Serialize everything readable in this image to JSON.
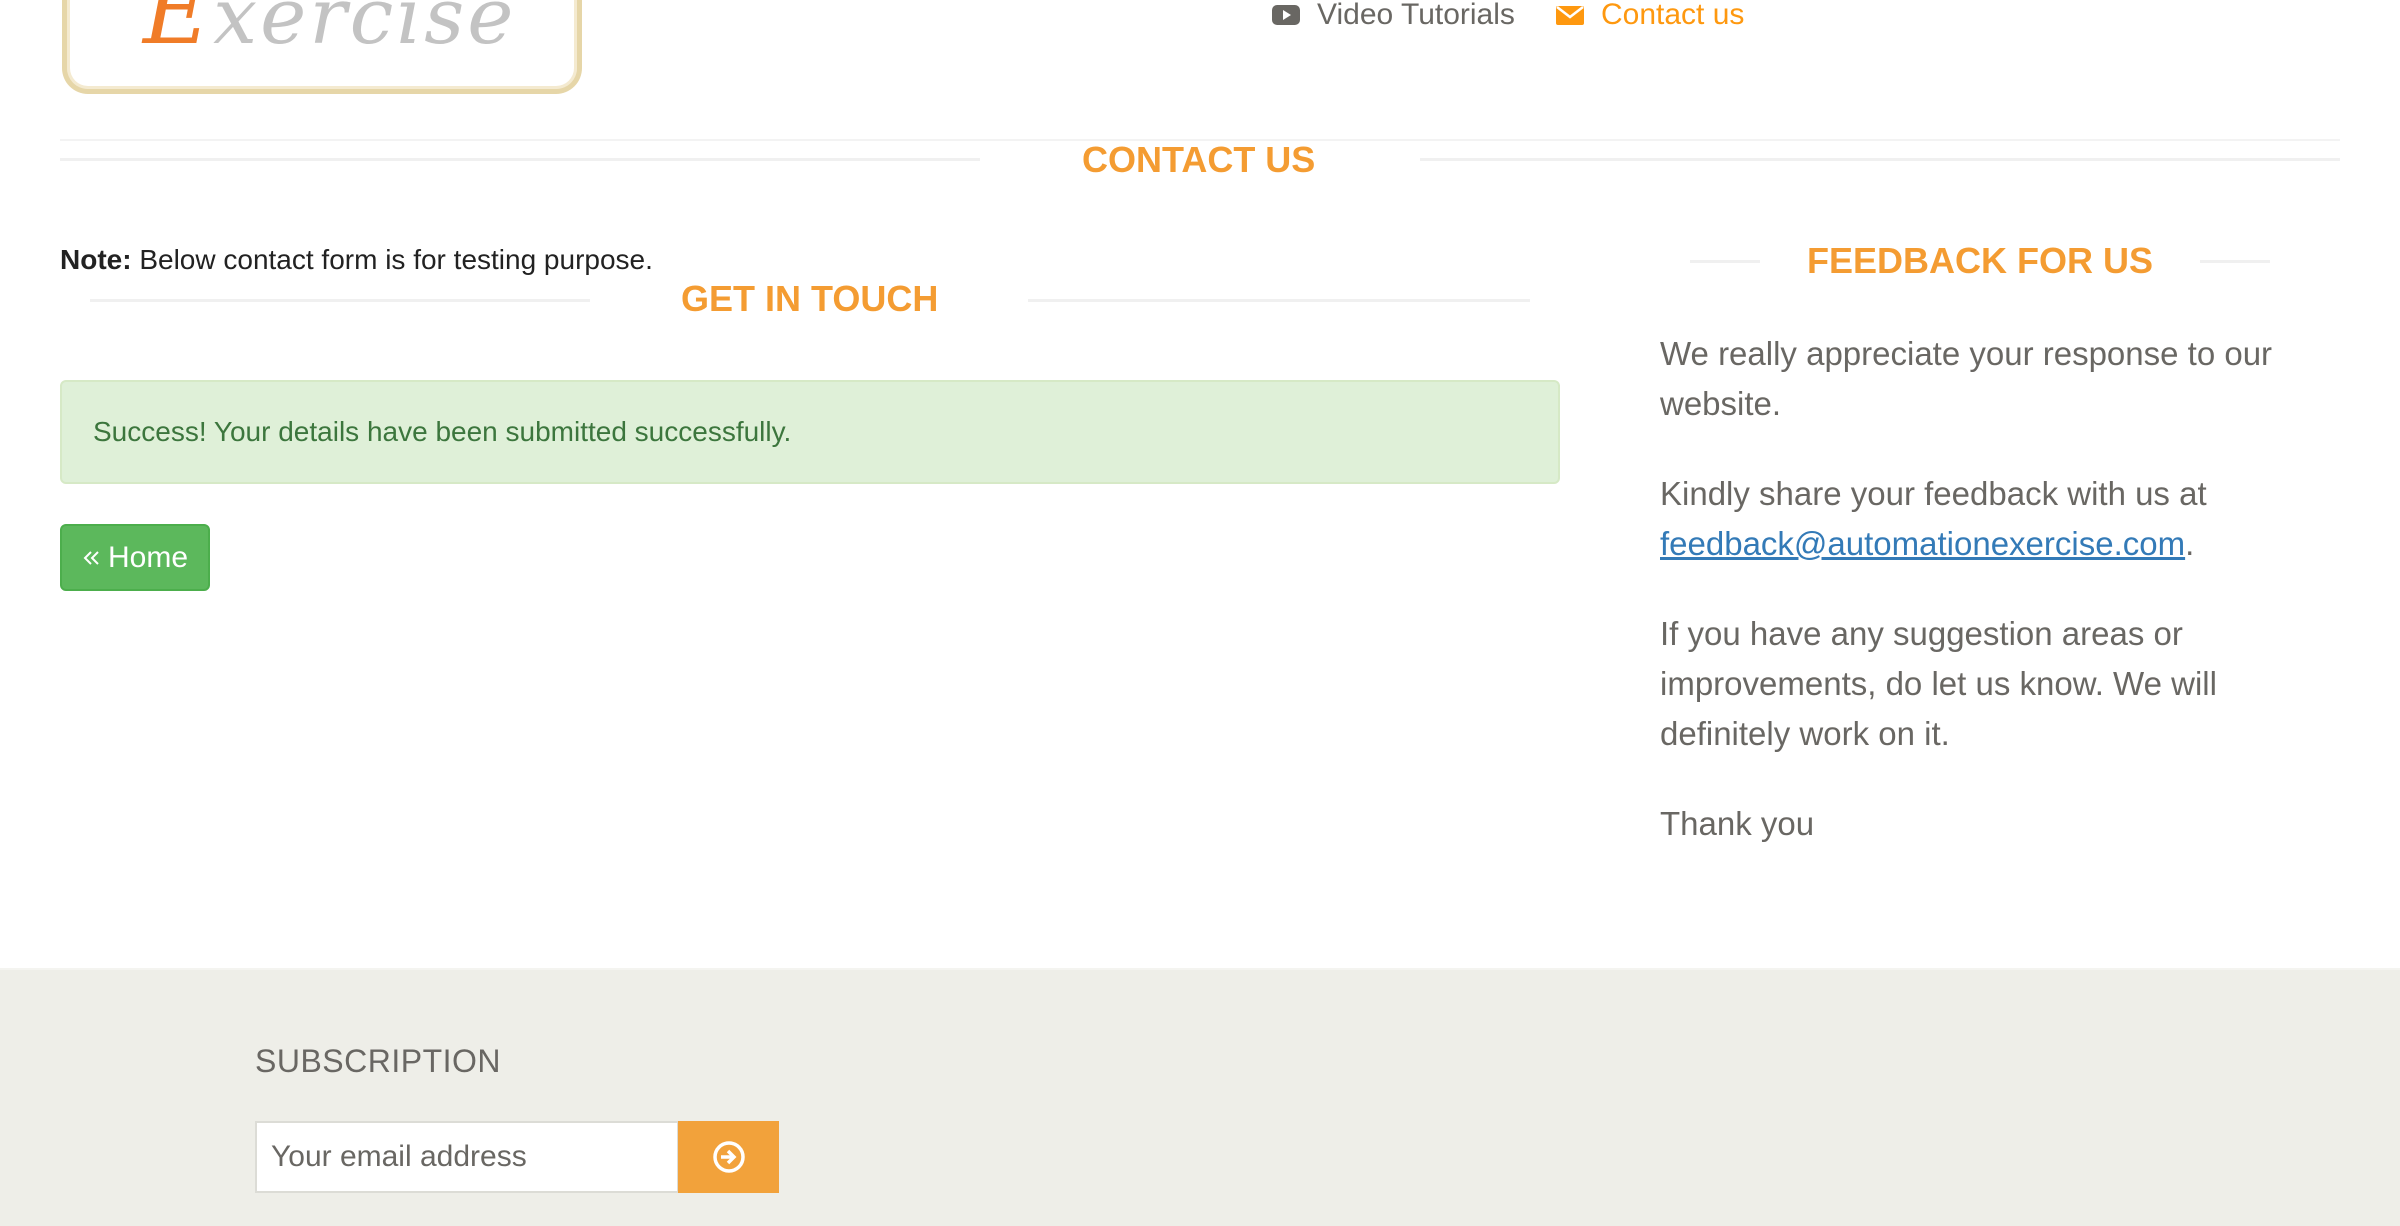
{
  "header": {
    "logo": {
      "first_letter": "E",
      "rest": "xercise"
    },
    "nav": {
      "video_label": "Video Tutorials",
      "contact_label": "Contact us"
    }
  },
  "contact": {
    "title": "CONTACT US",
    "note_bold": "Note:",
    "note_text": "Below contact form is for testing purpose.",
    "get_in_touch": "GET IN TOUCH",
    "alert": "Success! Your details have been submitted successfully.",
    "home_button": "Home",
    "home_icon": "double-chevron-left-icon"
  },
  "feedback": {
    "title": "FEEDBACK FOR US",
    "p1": "We really appreciate your response to our website.",
    "p2_prefix": "Kindly share your feedback with us at",
    "p2_email": "feedback@automationexercise.com",
    "p2_suffix": ".",
    "p3": "If you have any suggestion areas or improvements, do let us know. We will definitely work on it.",
    "p4": "Thank you"
  },
  "footer": {
    "subscription_title": "SUBSCRIPTION",
    "email_placeholder": "Your email address",
    "subscribe_icon": "arrow-circle-right-icon"
  },
  "colors": {
    "accent": "#fe980f",
    "title_orange": "#f49c32",
    "success_bg": "#dff0d8",
    "success_text": "#3c763d",
    "home_btn": "#5cb85c",
    "footer_bg": "#eeeee8",
    "link": "#337ab7"
  }
}
